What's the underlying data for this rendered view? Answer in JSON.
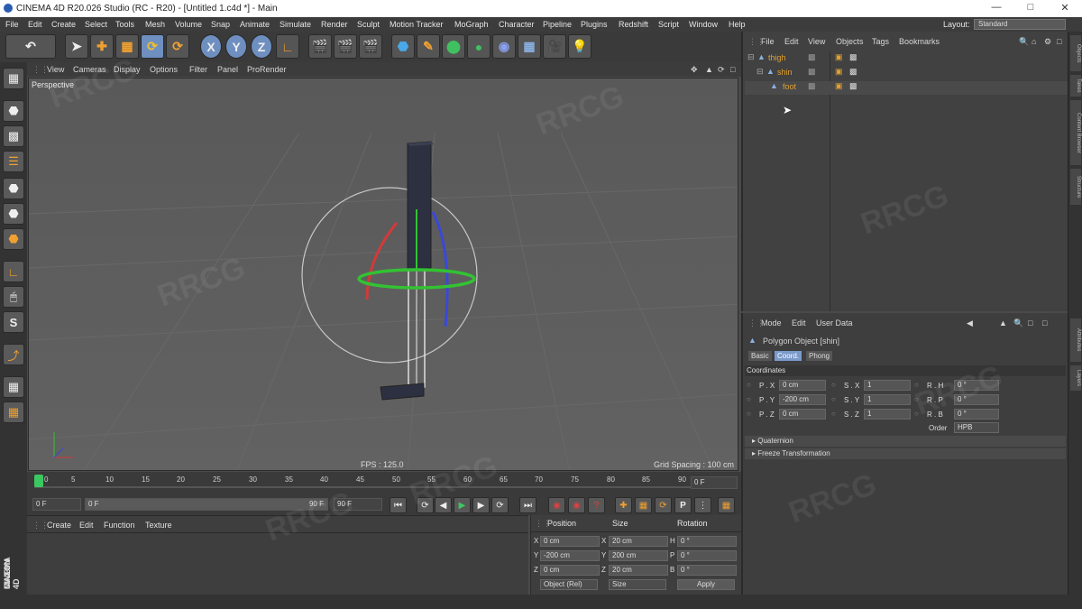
{
  "window": {
    "title": "CINEMA 4D R20.026 Studio (RC - R20) - [Untitled 1.c4d *] - Main"
  },
  "menubar": {
    "items": [
      "File",
      "Edit",
      "Create",
      "Select",
      "Tools",
      "Mesh",
      "Volume",
      "Snap",
      "Animate",
      "Simulate",
      "Render",
      "Sculpt",
      "Motion Tracker",
      "MoGraph",
      "Character",
      "Pipeline",
      "Plugins",
      "Redshift",
      "Script",
      "Window",
      "Help"
    ],
    "layout_label": "Layout:",
    "layout_value": "Standard"
  },
  "toolbar": {
    "axis_x": "X",
    "axis_y": "Y",
    "axis_z": "Z"
  },
  "viewport": {
    "menu": [
      "View",
      "Cameras",
      "Display",
      "Options",
      "Filter",
      "Panel",
      "ProRender"
    ],
    "label": "Perspective",
    "fps": "FPS : 125.0",
    "grid_spacing": "Grid Spacing : 100 cm"
  },
  "timeline": {
    "ticks": [
      "0",
      "5",
      "10",
      "15",
      "20",
      "25",
      "30",
      "35",
      "40",
      "45",
      "50",
      "55",
      "60",
      "65",
      "70",
      "75",
      "80",
      "85",
      "90"
    ],
    "current_frame": "0 F",
    "start_frame": "0 F",
    "range_start": "0 F",
    "range_end": "90 F",
    "end_frame": "90 F"
  },
  "material_manager": {
    "menu": [
      "Create",
      "Edit",
      "Function",
      "Texture"
    ]
  },
  "coord_manager": {
    "headers": {
      "position": "Position",
      "size": "Size",
      "rotation": "Rotation"
    },
    "rows": [
      {
        "axis": "X",
        "pos": "0 cm",
        "size_axis": "X",
        "size": "20 cm",
        "rot_axis": "H",
        "rot": "0 °"
      },
      {
        "axis": "Y",
        "pos": "-200 cm",
        "size_axis": "Y",
        "size": "200 cm",
        "rot_axis": "P",
        "rot": "0 °"
      },
      {
        "axis": "Z",
        "pos": "0 cm",
        "size_axis": "Z",
        "size": "20 cm",
        "rot_axis": "B",
        "rot": "0 °"
      }
    ],
    "mode": "Object (Rel)",
    "size_mode": "Size",
    "apply": "Apply"
  },
  "object_manager": {
    "menu": [
      "File",
      "Edit",
      "View",
      "Objects",
      "Tags",
      "Bookmarks"
    ],
    "objects": [
      "thigh",
      "shin",
      "foot"
    ]
  },
  "attribute_manager": {
    "menu": [
      "Mode",
      "Edit",
      "User Data"
    ],
    "object_title": "Polygon Object [shin]",
    "tabs": [
      "Basic",
      "Coord.",
      "Phong"
    ],
    "section": "Coordinates",
    "fields": [
      {
        "p_label": "P . X",
        "p_val": "0 cm",
        "s_label": "S . X",
        "s_val": "1",
        "r_label": "R . H",
        "r_val": "0 °"
      },
      {
        "p_label": "P . Y",
        "p_val": "-200 cm",
        "s_label": "S . Y",
        "s_val": "1",
        "r_label": "R . P",
        "r_val": "0 °"
      },
      {
        "p_label": "P . Z",
        "p_val": "0 cm",
        "s_label": "S . Z",
        "s_val": "1",
        "r_label": "R . B",
        "r_val": "0 °"
      }
    ],
    "order_label": "Order",
    "order_value": "HPB",
    "collapsed": [
      "Quaternion",
      "Freeze Transformation"
    ]
  },
  "side_tabs": [
    "Objects",
    "Takes",
    "Content Browser",
    "Structure",
    "Attributes",
    "Layers"
  ],
  "watermark": "RRCG",
  "branding": {
    "vendor": "MAXON",
    "product": "CINEMA 4D"
  },
  "colors": {
    "axis_x": "#d23a3a",
    "axis_y": "#33c233",
    "axis_z": "#3a48d8",
    "selection": "#6e8fc0",
    "object_name": "#e0a030"
  }
}
